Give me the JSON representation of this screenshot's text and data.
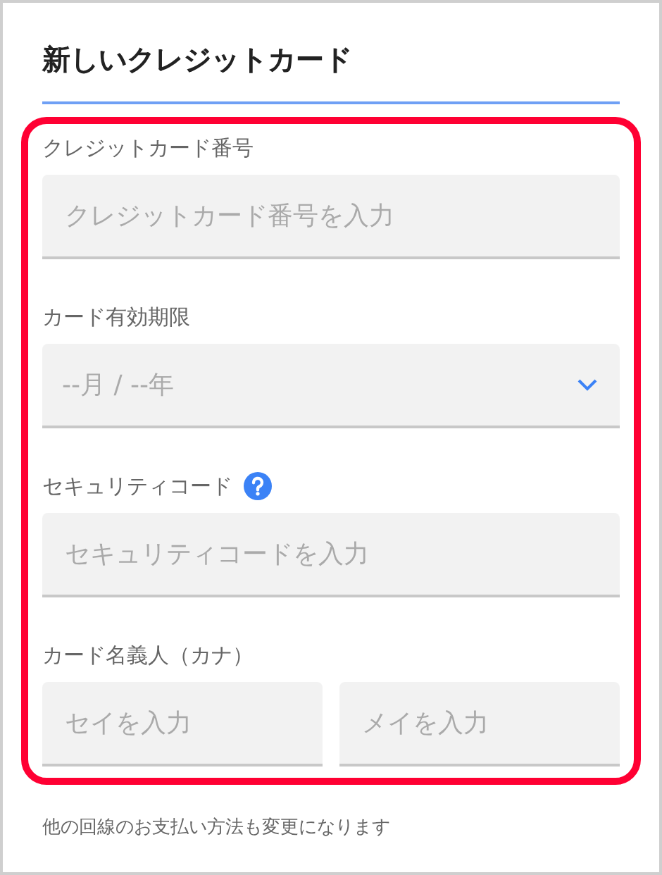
{
  "title": "新しいクレジットカード",
  "fields": [
    {
      "kind": "text",
      "label": "クレジットカード番号",
      "help": false,
      "inputs": [
        {
          "placeholder": "クレジットカード番号を入力"
        }
      ]
    },
    {
      "kind": "select",
      "label": "カード有効期限",
      "help": false,
      "inputs": [
        {
          "placeholder": "--月 / --年"
        }
      ]
    },
    {
      "kind": "text",
      "label": "セキュリティコード",
      "help": true,
      "inputs": [
        {
          "placeholder": "セキュリティコードを入力"
        }
      ]
    },
    {
      "kind": "text",
      "label": "カード名義人（カナ）",
      "help": false,
      "inputs": [
        {
          "placeholder": "セイを入力"
        },
        {
          "placeholder": "メイを入力"
        }
      ]
    }
  ],
  "note": "他の回線のお支払い方法も変更になります"
}
